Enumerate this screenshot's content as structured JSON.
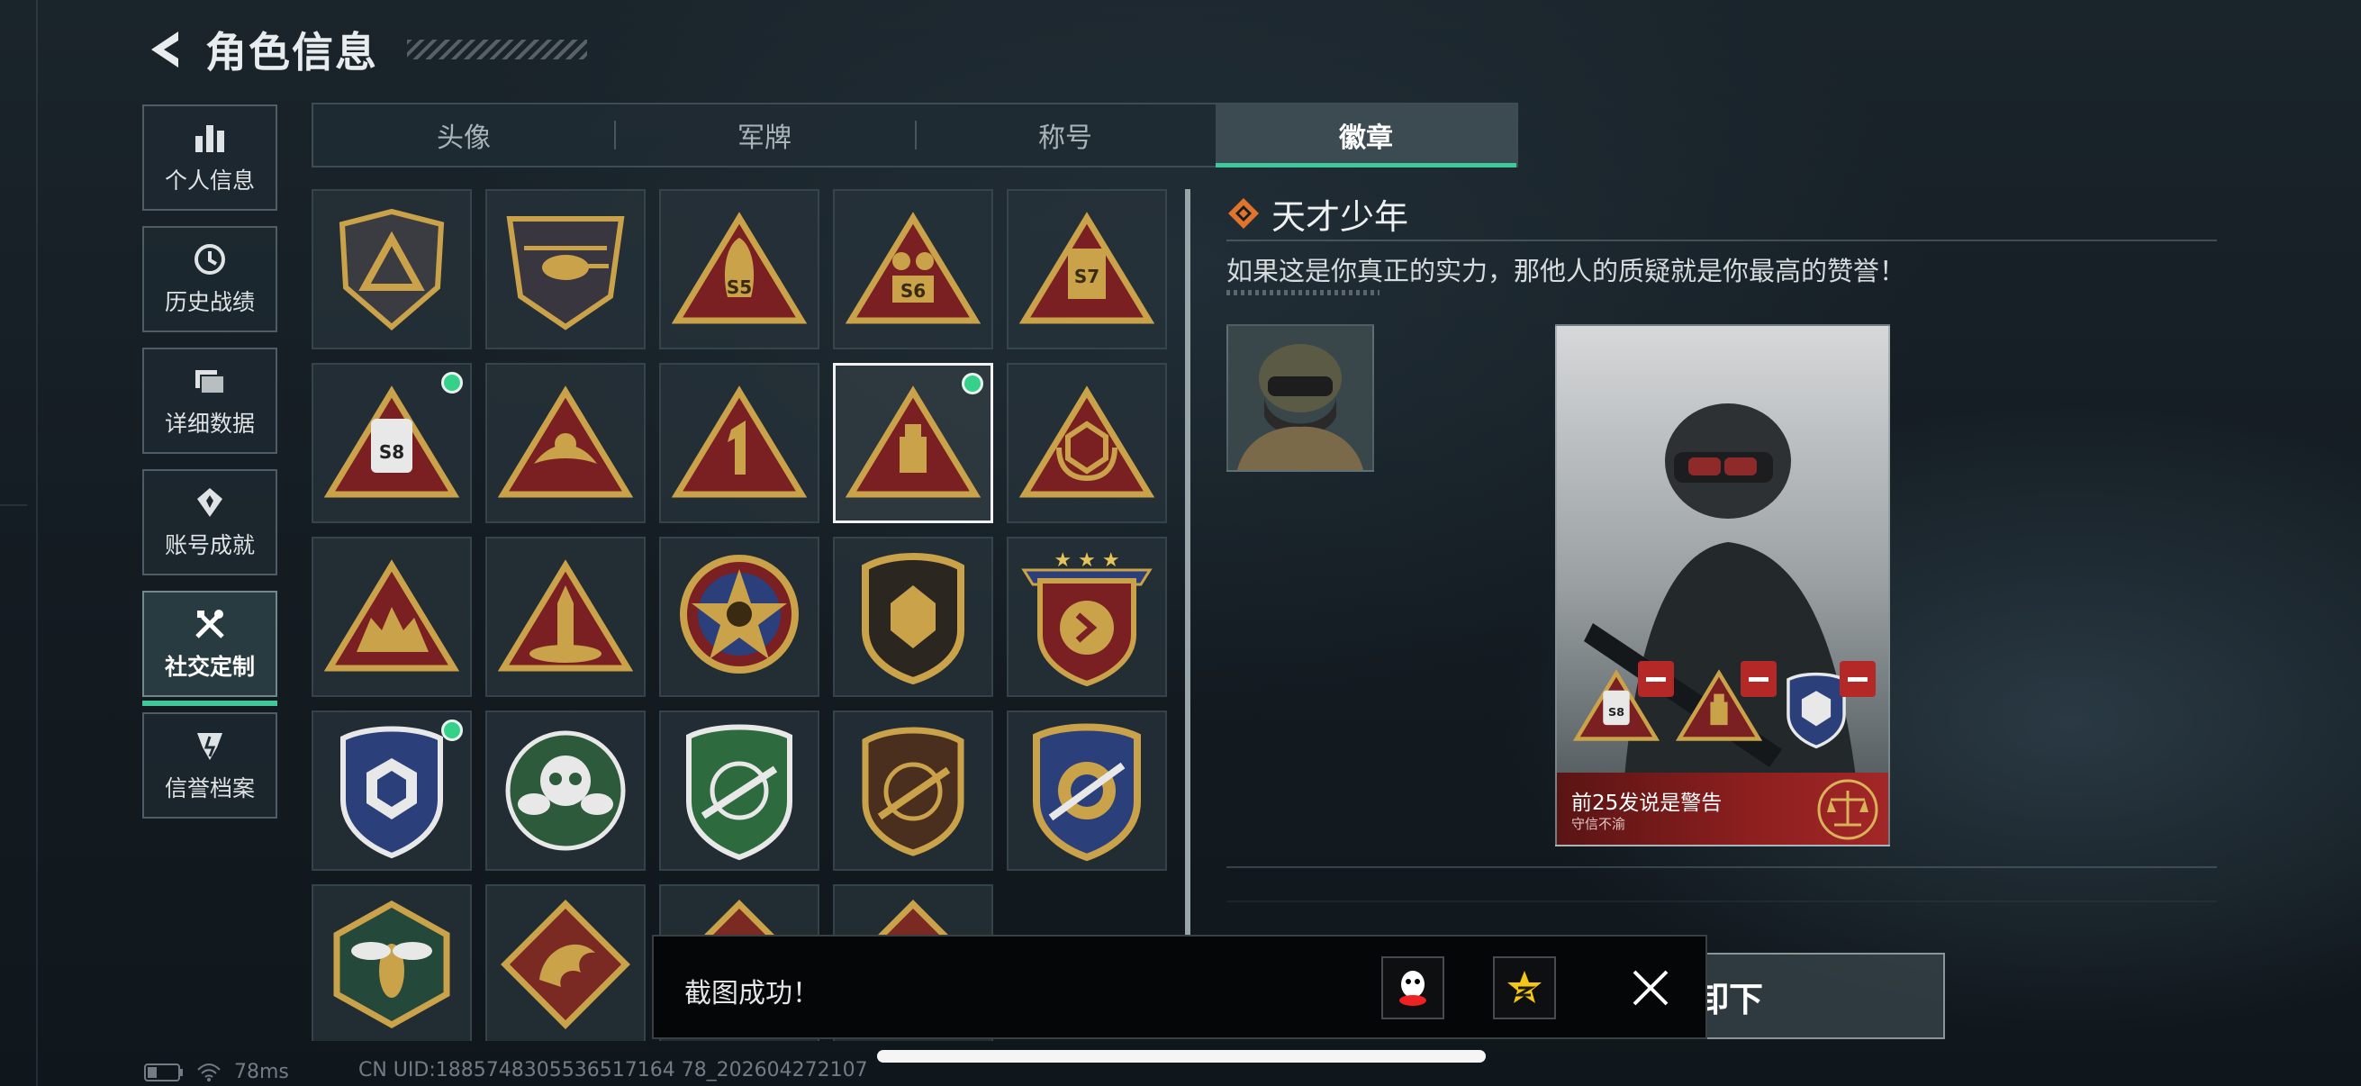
{
  "header": {
    "title": "角色信息"
  },
  "nav": {
    "items": [
      {
        "label": "个人信息",
        "icon": "bar-chart-icon"
      },
      {
        "label": "历史战绩",
        "icon": "history-icon"
      },
      {
        "label": "详细数据",
        "icon": "folder-icon"
      },
      {
        "label": "账号成就",
        "icon": "medal-icon"
      },
      {
        "label": "社交定制",
        "icon": "tools-icon",
        "active": true
      },
      {
        "label": "信誉档案",
        "icon": "reputation-icon"
      }
    ]
  },
  "tabs": [
    {
      "label": "头像"
    },
    {
      "label": "军牌"
    },
    {
      "label": "称号"
    },
    {
      "label": "徽章",
      "active": true
    }
  ],
  "detail": {
    "name": "天才少年",
    "description": "如果这是你真正的实力，那他人的质疑就是你最高的赞誉！",
    "card_title": "前25发说是警告",
    "card_subtitle": "守信不渝"
  },
  "button": {
    "label": "卸下"
  },
  "toast": {
    "message": "截图成功！"
  },
  "status": {
    "ping": "78ms",
    "uid": "CN UID:1885748305536517164 78_202604272107"
  },
  "colors": {
    "accent": "#3fc99a",
    "badge_gold": "#c9a24a",
    "badge_red": "#7a1f22",
    "background": "#141c22"
  }
}
